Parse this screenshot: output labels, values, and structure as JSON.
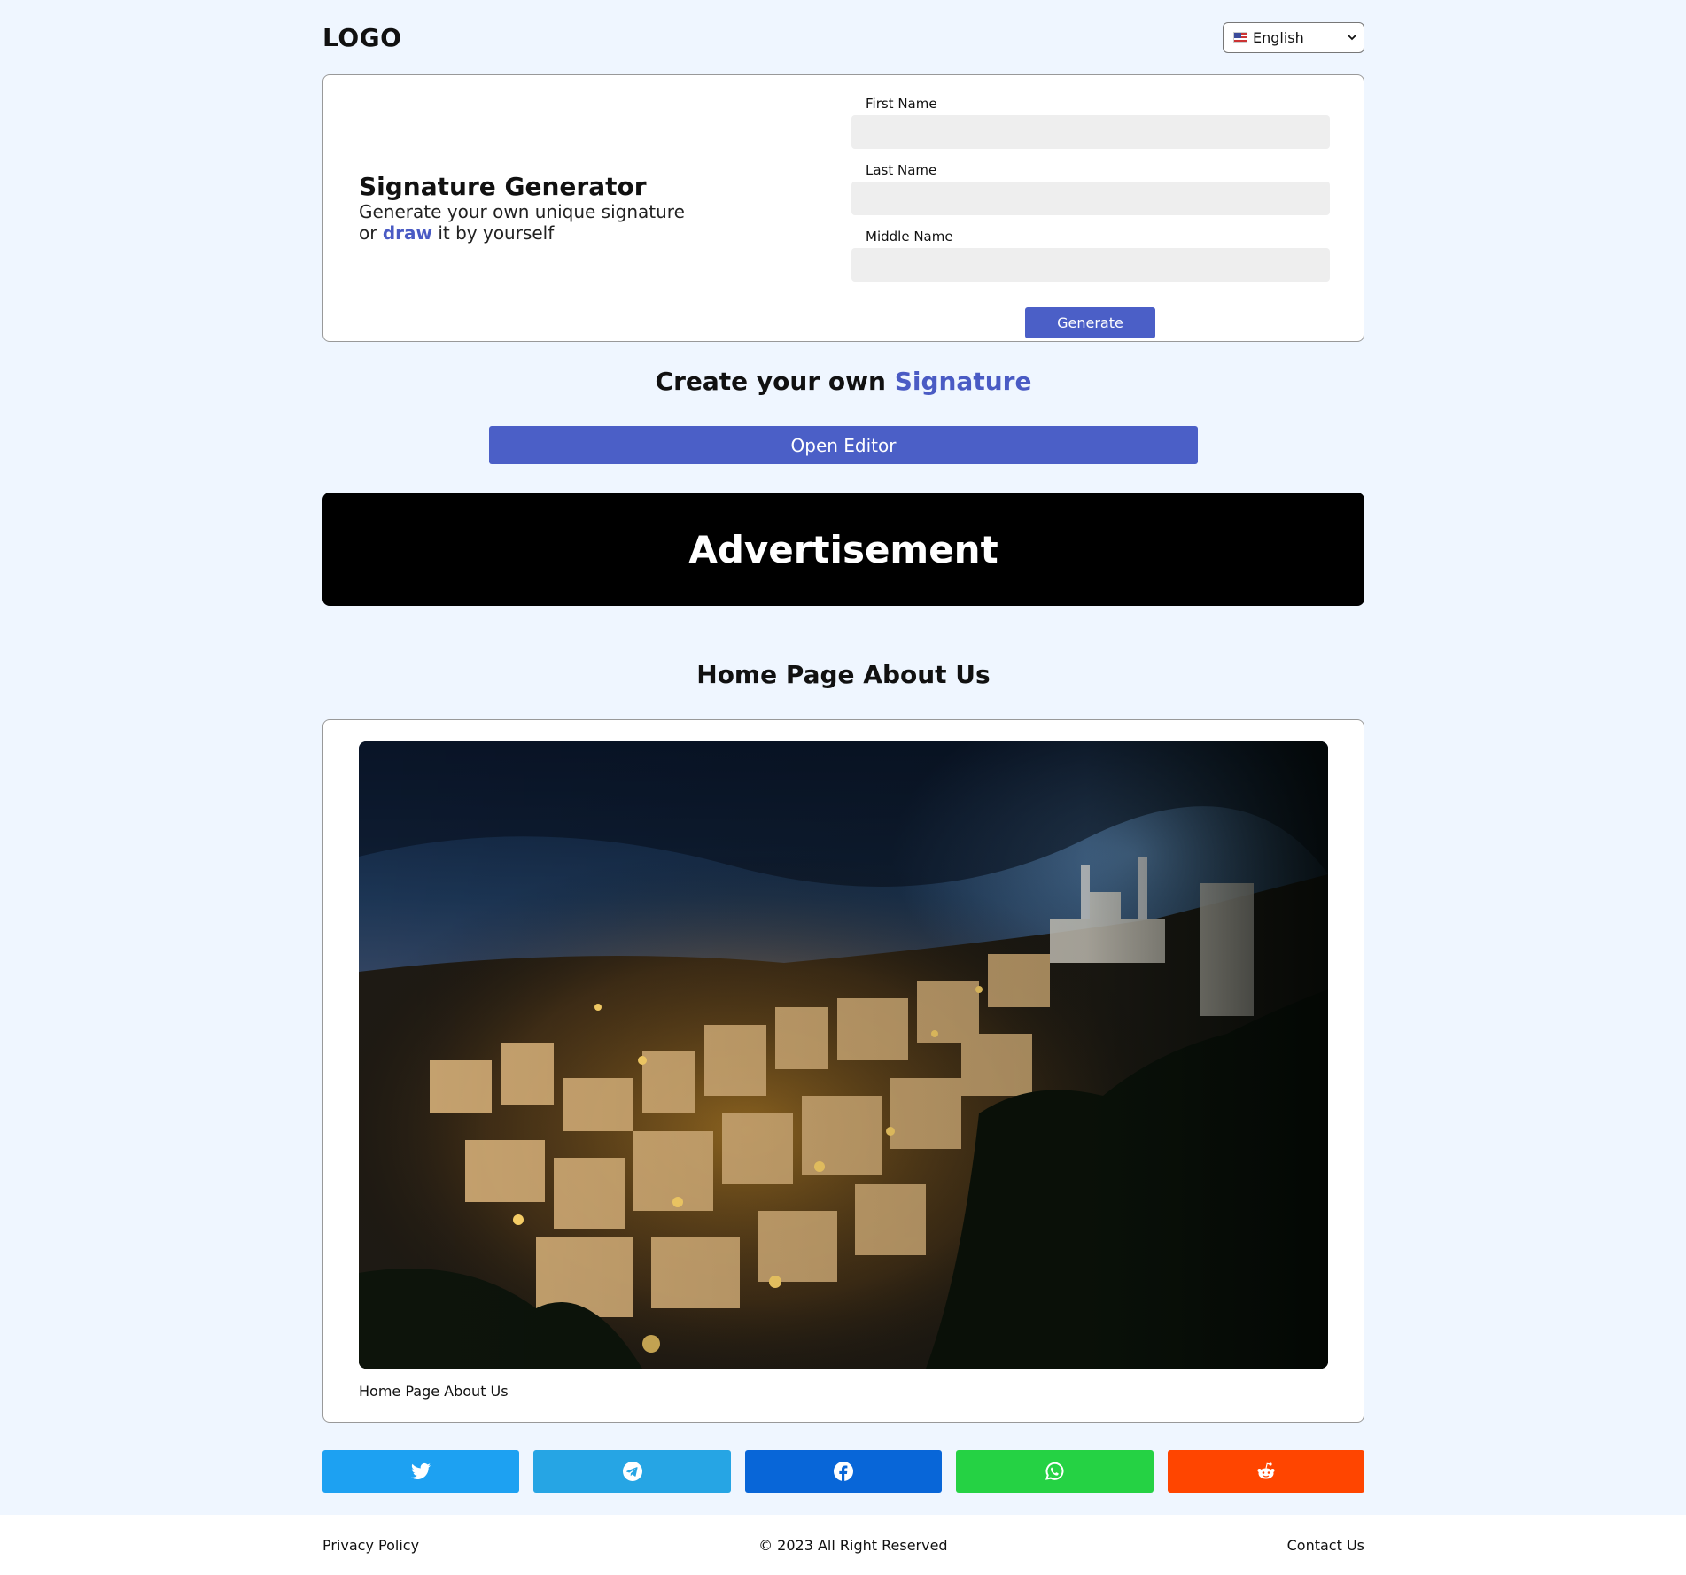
{
  "header": {
    "logo": "LOGO",
    "language": {
      "selected": "English",
      "icon": "us-flag-icon"
    }
  },
  "generator": {
    "title": "Signature Generator",
    "subtitle_line1": "Generate your own unique signature",
    "subtitle_or": "or",
    "subtitle_draw": "draw",
    "subtitle_rest": "it by yourself",
    "fields": {
      "first_name": {
        "label": "First Name",
        "value": ""
      },
      "last_name": {
        "label": "Last Name",
        "value": ""
      },
      "middle_name": {
        "label": "Middle Name",
        "value": ""
      }
    },
    "generate_label": "Generate"
  },
  "create": {
    "title_prefix": "Create your own",
    "title_accent": "Signature",
    "open_editor_label": "Open Editor"
  },
  "ad": {
    "label": "Advertisement"
  },
  "about": {
    "title": "Home Page About Us",
    "caption": "Home Page About Us"
  },
  "share": {
    "buttons": [
      {
        "name": "twitter",
        "icon": "twitter-icon",
        "color": "#1da1f2"
      },
      {
        "name": "telegram",
        "icon": "telegram-icon",
        "color": "#26a5e4"
      },
      {
        "name": "facebook",
        "icon": "facebook-icon",
        "color": "#0866d8"
      },
      {
        "name": "whatsapp",
        "icon": "whatsapp-icon",
        "color": "#25d244"
      },
      {
        "name": "reddit",
        "icon": "reddit-icon",
        "color": "#ff4500"
      }
    ]
  },
  "footer": {
    "privacy": "Privacy Policy",
    "copyright": "© 2023 All Right Reserved",
    "contact": "Contact Us"
  },
  "colors": {
    "accent": "#4a5bc4",
    "background": "#eff6ff"
  }
}
